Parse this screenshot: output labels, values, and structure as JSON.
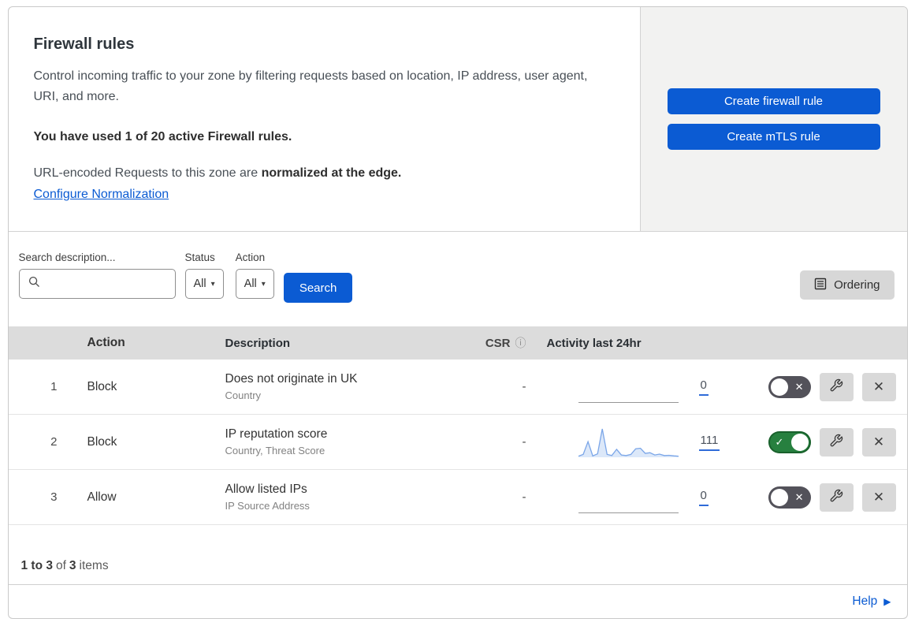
{
  "colors": {
    "accent_blue": "#0b5bd3",
    "toggle_green": "#27803f",
    "toggle_off_gray": "#53525a",
    "panel_gray": "#f2f2f1",
    "header_band_gray": "#dcdcdc",
    "sparkline_blue": "#7ba6e8"
  },
  "icons": {
    "caret": "▾",
    "check": "✓",
    "cross": "✕",
    "info": "ⓘ",
    "help_arrow": "▶"
  },
  "header": {
    "title": "Firewall rules",
    "description": "Control incoming traffic to your zone by filtering requests based on location, IP address, user agent, URI, and more.",
    "usage": "You have used 1 of 20 active Firewall rules.",
    "normalization_prefix": "URL-encoded Requests to this zone are ",
    "normalization_bold": "normalized at the edge.",
    "normalization_link": "Configure Normalization",
    "create_firewall_button": "Create firewall rule",
    "create_mtls_button": "Create mTLS rule"
  },
  "filters": {
    "search_label": "Search description...",
    "search_value": "",
    "status_label": "Status",
    "status_value": "All",
    "action_label": "Action",
    "action_value": "All",
    "search_button": "Search",
    "ordering_button": "Ordering"
  },
  "table": {
    "columns": {
      "action": "Action",
      "description": "Description",
      "csr": "CSR",
      "activity": "Activity last 24hr"
    },
    "rows": [
      {
        "number": "1",
        "action": "Block",
        "description": "Does not originate in UK",
        "criteria": "Country",
        "csr": "-",
        "activity_count": "0",
        "enabled": false
      },
      {
        "number": "2",
        "action": "Block",
        "description": "IP reputation score",
        "criteria": "Country, Threat Score",
        "csr": "-",
        "activity_count": "111",
        "enabled": true
      },
      {
        "number": "3",
        "action": "Allow",
        "description": "Allow listed IPs",
        "criteria": "IP Source Address",
        "csr": "-",
        "activity_count": "0",
        "enabled": false
      }
    ],
    "sparkline_values": [
      4,
      10,
      55,
      5,
      12,
      100,
      10,
      6,
      28,
      8,
      6,
      10,
      30,
      32,
      14,
      16,
      8,
      11,
      6,
      7,
      5,
      4
    ]
  },
  "footer": {
    "range": "1 to 3",
    "of": "of",
    "total": "3",
    "items_label": "items"
  },
  "help": {
    "label": "Help"
  }
}
